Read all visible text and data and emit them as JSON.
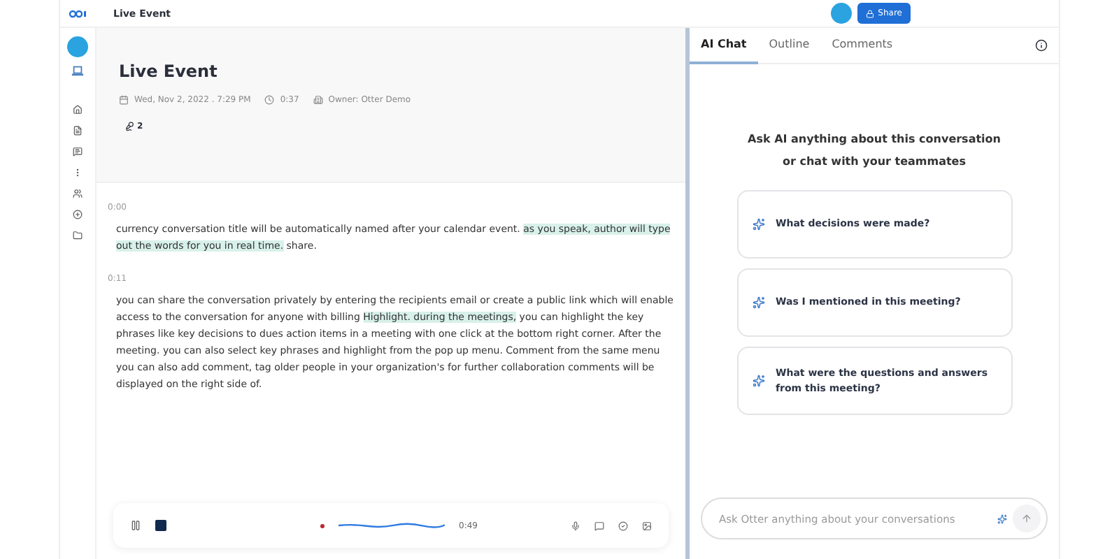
{
  "top_bar": {
    "title": "Live Event",
    "share_button": "Share"
  },
  "sidebar": {
    "items": [
      {
        "selected": false
      },
      {
        "selected": false
      },
      {
        "selected": false
      },
      {
        "selected": false
      },
      {
        "selected": false
      },
      {
        "selected": false
      },
      {
        "selected": false
      }
    ]
  },
  "conversation": {
    "title": "Live Event",
    "date": "Wed, Nov 2, 2022 . 7:29 PM",
    "duration": "0:37",
    "owner": "Owner: Otter Demo",
    "speakers": "2",
    "segments": [
      {
        "time": "0:00",
        "parts": [
          {
            "text": "currency conversation title will be automatically named after your calendar event. ",
            "highlighted": false
          },
          {
            "text": "as you speak, author will type out the words for you in real time.",
            "highlighted": true
          },
          {
            "text": " share.",
            "highlighted": false
          }
        ]
      },
      {
        "time": "0:11",
        "parts": [
          {
            "text": "you can share the conversation privately by entering the recipients email or create a public link which will enable access to the conversation for anyone with billing ",
            "highlighted": false
          },
          {
            "text": "Highlight. during the meetings,",
            "highlighted": true
          },
          {
            "text": " you can highlight the key phrases like key decisions to dues action items in a meeting with one click at the bottom right corner. After the meeting. you can also select key phrases and highlight from the pop up menu. Comment from the same menu you can also add comment, tag older people in your organization's for further collaboration comments will be displayed on the right side of.",
            "highlighted": false
          }
        ]
      }
    ]
  },
  "player": {
    "recording": true,
    "elapsed": "0:49"
  },
  "panel": {
    "tabs": [
      {
        "label": "AI Chat",
        "selected": true
      },
      {
        "label": "Outline",
        "selected": false
      },
      {
        "label": "Comments",
        "selected": false
      }
    ],
    "intro": [
      "Ask AI anything about this conversation",
      "or chat with your teammates"
    ],
    "suggestions": [
      "What decisions were made?",
      "Was I mentioned in this meeting?",
      "What were the questions and answers from this meeting?"
    ],
    "input": {
      "placeholder": "Ask Otter anything about your conversations"
    }
  }
}
